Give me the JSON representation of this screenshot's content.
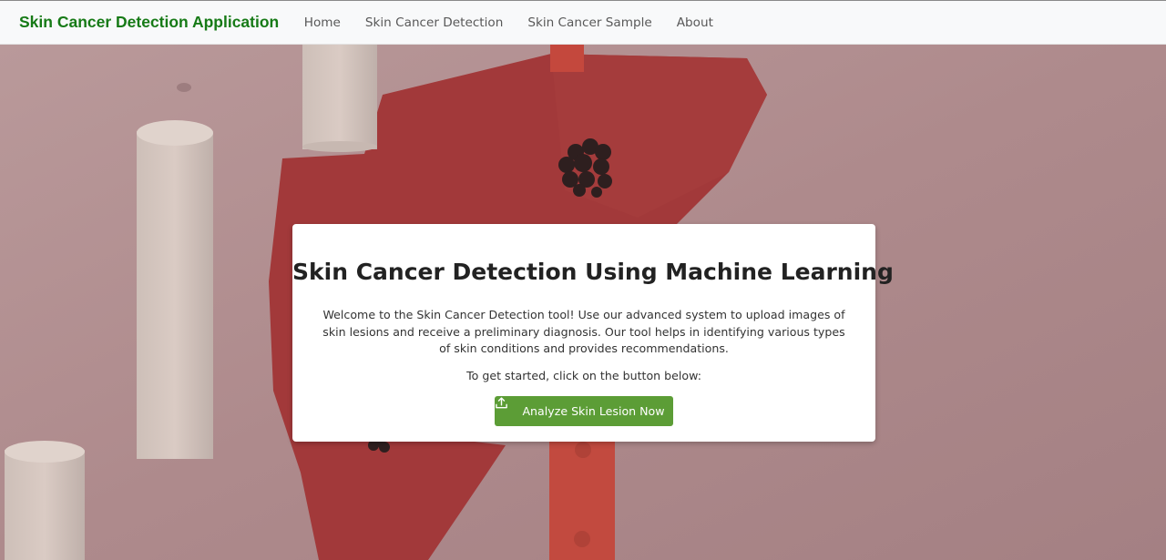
{
  "navbar": {
    "brand": "Skin Cancer Detection Application",
    "links": [
      "Home",
      "Skin Cancer Detection",
      "Skin Cancer Sample",
      "About"
    ]
  },
  "hero": {
    "title": "Skin Cancer Detection Using Machine Learning",
    "description": "Welcome to the Skin Cancer Detection tool! Use our advanced system to upload images of skin lesions and receive a preliminary diagnosis. Our tool helps in identifying various types of skin conditions and provides recommendations.",
    "cta_text": "To get started, click on the button below:",
    "button_label": "Analyze Skin Lesion Now",
    "button_icon": "upload-icon"
  },
  "colors": {
    "brand": "#167a16",
    "button": "#5c9d36",
    "navbar_bg": "#f8f9fa"
  }
}
